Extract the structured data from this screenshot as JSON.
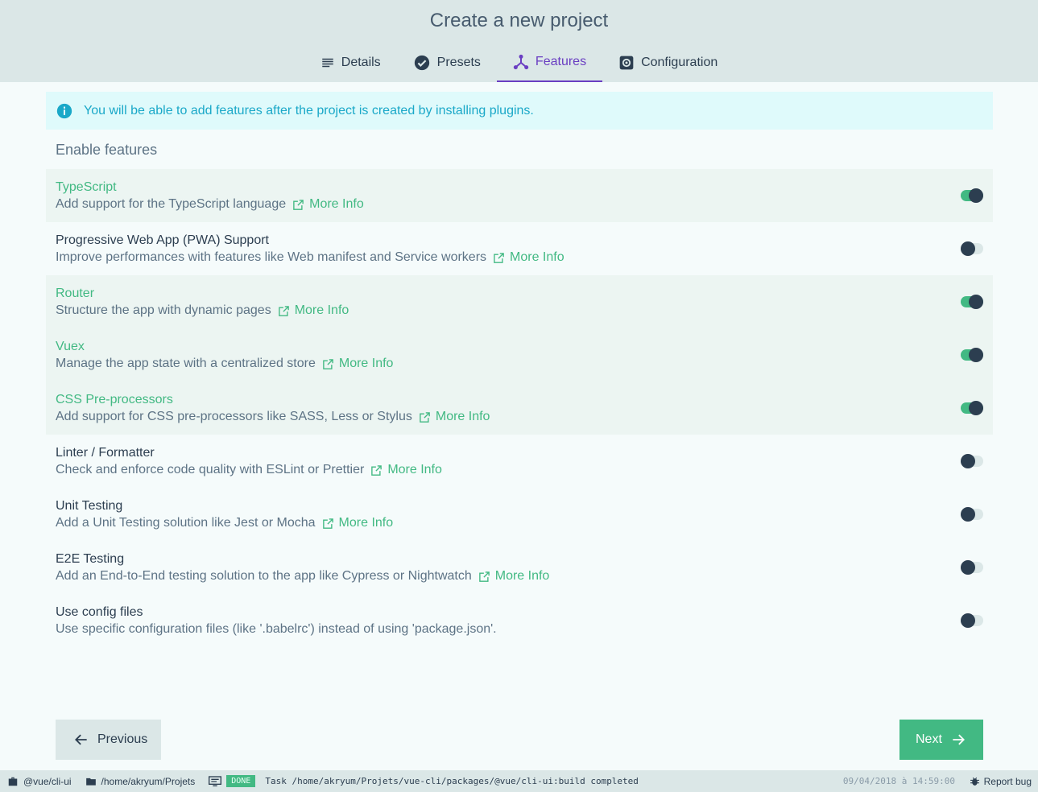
{
  "header": {
    "title": "Create a new project",
    "tabs": [
      {
        "label": "Details",
        "icon": "list-icon",
        "active": false
      },
      {
        "label": "Presets",
        "icon": "check-circle-icon",
        "active": false
      },
      {
        "label": "Features",
        "icon": "device-hub-icon",
        "active": true
      },
      {
        "label": "Configuration",
        "icon": "settings-box-icon",
        "active": false
      }
    ]
  },
  "info_banner": {
    "text": "You will be able to add features after the project is created by installing plugins."
  },
  "section_title": "Enable features",
  "more_info_label": "More Info",
  "features": [
    {
      "name": "TypeScript",
      "description": "Add support for the TypeScript language",
      "more_info": true,
      "enabled": true
    },
    {
      "name": "Progressive Web App (PWA) Support",
      "description": "Improve performances with features like Web manifest and Service workers",
      "more_info": true,
      "enabled": false
    },
    {
      "name": "Router",
      "description": "Structure the app with dynamic pages",
      "more_info": true,
      "enabled": true
    },
    {
      "name": "Vuex",
      "description": "Manage the app state with a centralized store",
      "more_info": true,
      "enabled": true
    },
    {
      "name": "CSS Pre-processors",
      "description": "Add support for CSS pre-processors like SASS, Less or Stylus",
      "more_info": true,
      "enabled": true
    },
    {
      "name": "Linter / Formatter",
      "description": "Check and enforce code quality with ESLint or Prettier",
      "more_info": true,
      "enabled": false
    },
    {
      "name": "Unit Testing",
      "description": "Add a Unit Testing solution like Jest or Mocha",
      "more_info": true,
      "enabled": false
    },
    {
      "name": "E2E Testing",
      "description": "Add an End-to-End testing solution to the app like Cypress or Nightwatch",
      "more_info": true,
      "enabled": false
    },
    {
      "name": "Use config files",
      "description": "Use specific configuration files (like '.babelrc') instead of using 'package.json'.",
      "more_info": false,
      "enabled": false
    }
  ],
  "buttons": {
    "previous": "Previous",
    "next": "Next"
  },
  "statusbar": {
    "project": "@vue/cli-ui",
    "folder": "/home/akryum/Projets",
    "badge": "DONE",
    "log": "Task /home/akryum/Projets/vue-cli/packages/@vue/cli-ui:build completed",
    "timestamp": "09/04/2018 à 14:59:00",
    "report_bug": "Report bug"
  },
  "colors": {
    "accent": "#42b983",
    "active_tab": "#6a3ec2",
    "info": "#1aa8c8",
    "header_bg": "#dbe7e7"
  }
}
